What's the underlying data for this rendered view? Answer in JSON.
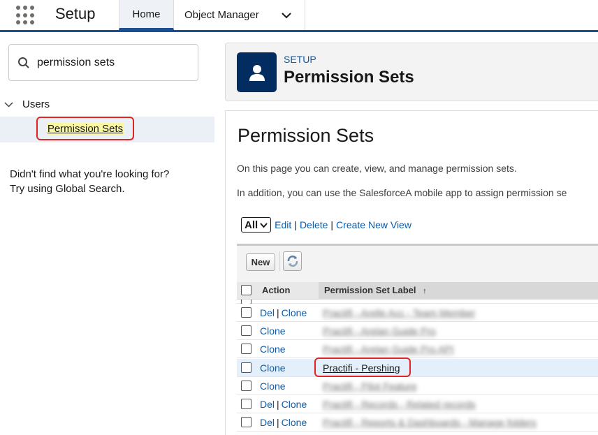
{
  "header": {
    "app_title": "Setup",
    "tabs": [
      {
        "label": "Home",
        "active": true
      },
      {
        "label": "Object Manager",
        "active": false
      }
    ]
  },
  "sidebar": {
    "search_value": "permission sets",
    "tree_group": "Users",
    "tree_item": "Permission Sets",
    "help_line1": "Didn't find what you're looking for?",
    "help_line2": "Try using Global Search."
  },
  "page_header": {
    "eyebrow": "SETUP",
    "title": "Permission Sets"
  },
  "content": {
    "heading": "Permission Sets",
    "desc1": "On this page you can create, view, and manage permission sets.",
    "desc2": "In addition, you can use the SalesforceA mobile app to assign permission se",
    "view_select": "All",
    "view_links": [
      "Edit",
      "Delete",
      "Create New View"
    ],
    "new_button": "New",
    "columns": {
      "action": "Action",
      "label": "Permission Set Label",
      "sort_indicator": "↑"
    },
    "rows": [
      {
        "del": "Del",
        "clone": "Clone",
        "label": "Practifi - Arelle Acc - Team Member",
        "blurred": true
      },
      {
        "del": "",
        "clone": "Clone",
        "label": "Practifi - Arelan Guide Pro",
        "blurred": true
      },
      {
        "del": "",
        "clone": "Clone",
        "label": "Practifi - Arelan Guide Pro API",
        "blurred": true
      },
      {
        "del": "",
        "clone": "Clone",
        "label": "Practifi - Pershing",
        "blurred": false,
        "highlighted": true
      },
      {
        "del": "",
        "clone": "Clone",
        "label": "Practifi - Pilot Feature",
        "blurred": true
      },
      {
        "del": "Del",
        "clone": "Clone",
        "label": "Practifi - Records - Related records",
        "blurred": true
      },
      {
        "del": "Del",
        "clone": "Clone",
        "label": "Practifi - Reports & Dashboards - Manage folders",
        "blurred": true
      }
    ]
  },
  "colors": {
    "brand_navy": "#032d60",
    "link_blue": "#0b5cab",
    "highlight_red": "#e02424",
    "search_highlight": "#fbf8a5"
  }
}
